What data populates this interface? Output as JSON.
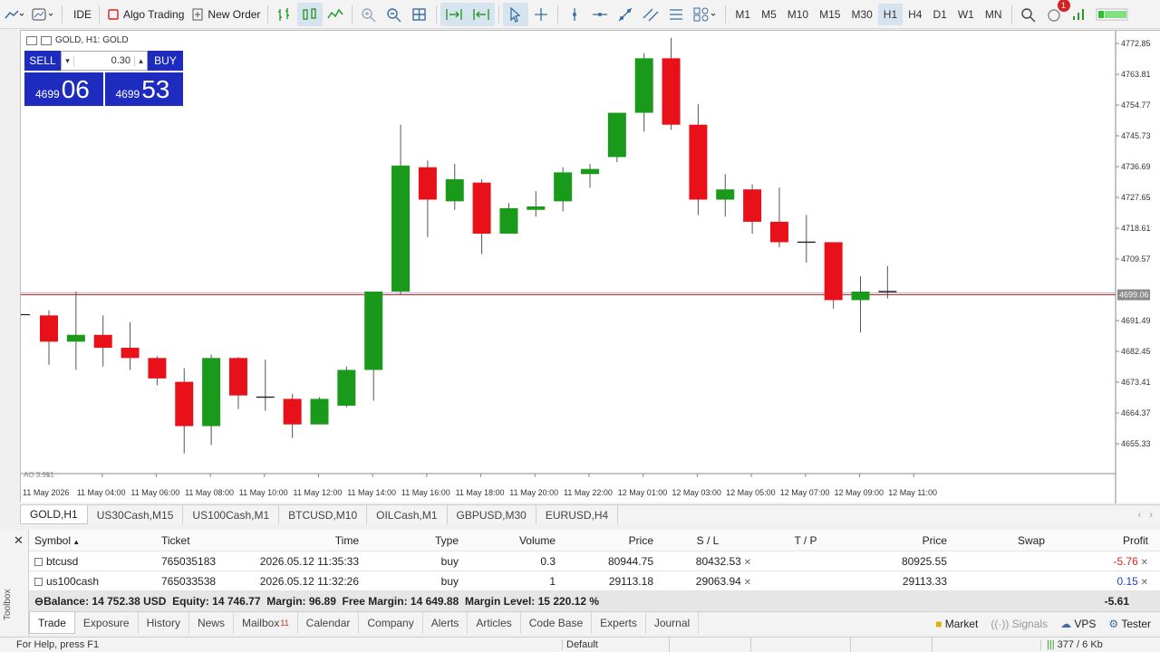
{
  "toolbar": {
    "ide_label": "IDE",
    "algo_label": "Algo Trading",
    "new_order_label": "New Order",
    "timeframes": [
      "M1",
      "M5",
      "M10",
      "M15",
      "M30",
      "H1",
      "H4",
      "D1",
      "W1",
      "MN"
    ],
    "active_timeframe": "H1",
    "notification_count": "1"
  },
  "chart": {
    "header": "GOLD, H1: GOLD",
    "sell_label": "SELL",
    "buy_label": "BUY",
    "volume": "0.30",
    "sell_price_small": "4699",
    "sell_price_big": "06",
    "buy_price_small": "4699",
    "buy_price_big": "53",
    "current_price": "4699.06",
    "indicator_label": "AO 3.951",
    "price_labels": [
      "4772.85",
      "4763.81",
      "4754.77",
      "4745.73",
      "4736.69",
      "4727.65",
      "4718.61",
      "4709.57",
      "4691.49",
      "4682.45",
      "4673.41",
      "4664.37",
      "4655.33"
    ],
    "time_labels": [
      "11 May 2026",
      "11 May 04:00",
      "11 May 06:00",
      "11 May 08:00",
      "11 May 10:00",
      "11 May 12:00",
      "11 May 14:00",
      "11 May 16:00",
      "11 May 18:00",
      "11 May 20:00",
      "11 May 22:00",
      "12 May 01:00",
      "12 May 03:00",
      "12 May 05:00",
      "12 May 07:00",
      "12 May 09:00",
      "12 May 11:00"
    ],
    "colors": {
      "bull": "#1a9a1a",
      "bear": "#e8111a",
      "bid_line": "#cc2222",
      "ask_line": "#b0b0d8"
    },
    "candles": [
      {
        "o": 4693.0,
        "h": 4694.5,
        "l": 4678.5,
        "c": 4685.3
      },
      {
        "o": 4685.3,
        "h": 4700.0,
        "l": 4677.0,
        "c": 4687.3
      },
      {
        "o": 4687.3,
        "h": 4693.0,
        "l": 4678.0,
        "c": 4683.5
      },
      {
        "o": 4683.5,
        "h": 4691.0,
        "l": 4677.0,
        "c": 4680.5
      },
      {
        "o": 4680.5,
        "h": 4681.0,
        "l": 4672.5,
        "c": 4674.5
      },
      {
        "o": 4673.5,
        "h": 4677.5,
        "l": 4652.5,
        "c": 4660.5
      },
      {
        "o": 4660.5,
        "h": 4681.5,
        "l": 4655.0,
        "c": 4680.5
      },
      {
        "o": 4680.5,
        "h": 4680.8,
        "l": 4665.5,
        "c": 4669.5
      },
      {
        "o": 4669.0,
        "h": 4680.0,
        "l": 4665.0,
        "c": 4669.0
      },
      {
        "o": 4668.5,
        "h": 4670.0,
        "l": 4657.0,
        "c": 4661.0
      },
      {
        "o": 4661.0,
        "h": 4669.0,
        "l": 4661.0,
        "c": 4668.5
      },
      {
        "o": 4666.5,
        "h": 4678.0,
        "l": 4666.0,
        "c": 4677.0
      },
      {
        "o": 4677.0,
        "h": 4700.0,
        "l": 4668.0,
        "c": 4700.0
      },
      {
        "o": 4700.0,
        "h": 4749.0,
        "l": 4699.0,
        "c": 4737.0
      },
      {
        "o": 4736.5,
        "h": 4738.5,
        "l": 4716.0,
        "c": 4727.0
      },
      {
        "o": 4726.5,
        "h": 4737.5,
        "l": 4724.0,
        "c": 4733.0
      },
      {
        "o": 4732.0,
        "h": 4733.0,
        "l": 4711.0,
        "c": 4717.0
      },
      {
        "o": 4717.0,
        "h": 4726.0,
        "l": 4717.0,
        "c": 4724.5
      },
      {
        "o": 4724.0,
        "h": 4729.5,
        "l": 4722.0,
        "c": 4725.0
      },
      {
        "o": 4726.5,
        "h": 4736.5,
        "l": 4723.5,
        "c": 4735.0
      },
      {
        "o": 4734.5,
        "h": 4737.5,
        "l": 4730.5,
        "c": 4736.0
      },
      {
        "o": 4739.5,
        "h": 4751.5,
        "l": 4738.0,
        "c": 4752.5
      },
      {
        "o": 4752.5,
        "h": 4770.0,
        "l": 4747.0,
        "c": 4768.5
      },
      {
        "o": 4768.5,
        "h": 4774.5,
        "l": 4747.5,
        "c": 4749.0
      },
      {
        "o": 4749.0,
        "h": 4755.0,
        "l": 4722.5,
        "c": 4727.0
      },
      {
        "o": 4727.0,
        "h": 4734.5,
        "l": 4722.0,
        "c": 4730.0
      },
      {
        "o": 4730.0,
        "h": 4731.5,
        "l": 4717.0,
        "c": 4720.5
      },
      {
        "o": 4720.5,
        "h": 4730.5,
        "l": 4713.0,
        "c": 4714.5
      },
      {
        "o": 4714.5,
        "h": 4722.5,
        "l": 4708.5,
        "c": 4714.5
      },
      {
        "o": 4714.5,
        "h": 4714.5,
        "l": 4695.0,
        "c": 4697.5
      },
      {
        "o": 4697.5,
        "h": 4704.5,
        "l": 4688.0,
        "c": 4700.0
      },
      {
        "o": 4700.0,
        "h": 4707.5,
        "l": 4698.0,
        "c": 4700.0
      }
    ]
  },
  "chart_tabs": [
    "GOLD,H1",
    "US30Cash,M15",
    "US100Cash,M1",
    "BTCUSD,M10",
    "OILCash,M1",
    "GBPUSD,M30",
    "EURUSD,H4"
  ],
  "toolbox": {
    "side_label": "Toolbox",
    "columns": [
      "Symbol",
      "Ticket",
      "Time",
      "Type",
      "Volume",
      "Price",
      "S / L",
      "T / P",
      "Price",
      "Swap",
      "Profit"
    ],
    "rows": [
      {
        "symbol": "btcusd",
        "ticket": "765035183",
        "time": "2026.05.12 11:35:33",
        "type": "buy",
        "volume": "0.3",
        "price": "80944.75",
        "sl": "80432.53",
        "tp": "",
        "cur_price": "80925.55",
        "swap": "",
        "profit": "-5.76"
      },
      {
        "symbol": "us100cash",
        "ticket": "765033538",
        "time": "2026.05.12 11:32:26",
        "type": "buy",
        "volume": "1",
        "price": "29113.18",
        "sl": "29063.94",
        "tp": "",
        "cur_price": "29113.33",
        "swap": "",
        "profit": "0.15"
      }
    ],
    "balance_line": "Balance: 14 752.38 USD  Equity: 14 746.77  Margin: 96.89  Free Margin: 14 649.88  Margin Level: 15 220.12 %",
    "total_profit": "-5.61",
    "tabs": [
      "Trade",
      "Exposure",
      "History",
      "News",
      "Mailbox",
      "Calendar",
      "Company",
      "Alerts",
      "Articles",
      "Code Base",
      "Experts",
      "Journal"
    ],
    "mailbox_count": "11",
    "right_tools": {
      "market": "Market",
      "signals": "Signals",
      "vps": "VPS",
      "tester": "Tester"
    }
  },
  "status": {
    "help": "For Help, press F1",
    "profile": "Default",
    "traffic": "377 / 6 Kb"
  }
}
